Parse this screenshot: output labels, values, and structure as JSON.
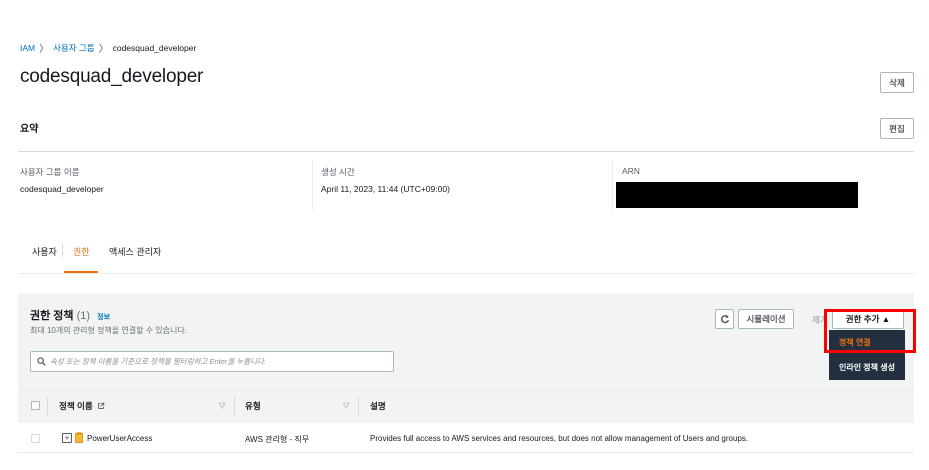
{
  "breadcrumb": {
    "root": "IAM",
    "sep": "〉",
    "middle": "사용자 그룹",
    "current": "codesquad_developer"
  },
  "page": {
    "title": "codesquad_developer",
    "delete_label": "삭제"
  },
  "summary": {
    "title": "요약",
    "edit_label": "편집",
    "fields": [
      {
        "label": "사용자 그룹 이름",
        "value": "codesquad_developer"
      },
      {
        "label": "생성 시간",
        "value": "April 11, 2023, 11:44 (UTC+09:00)"
      },
      {
        "label": "ARN",
        "value": ""
      }
    ]
  },
  "tabs": [
    {
      "label": "사용자"
    },
    {
      "label": "권한"
    },
    {
      "label": "액세스 관리자"
    }
  ],
  "permissions": {
    "title": "권한 정책",
    "count": "(1)",
    "info_label": "정보",
    "subtitle": "최대 10개의 관리형 정책을 연결할 수 있습니다.",
    "search_placeholder": "속성 또는 정책 이름을 기준으로 정책을 필터링하고 Enter를 누릅니다.",
    "simulate_label": "시뮬레이션",
    "remove_label": "제거",
    "add_label": "권한 추가 ▲",
    "dropdown": {
      "attach_label": "정책 연결",
      "inline_label": "인라인 정책 생성"
    },
    "columns": {
      "name": "정책 이름",
      "type": "유형",
      "description": "설명"
    },
    "rows": [
      {
        "name": "PowerUserAccess",
        "type": "AWS 관리형 - 직무",
        "description": "Provides full access to AWS services and resources, but does not allow management of Users and groups."
      }
    ]
  },
  "colors": {
    "accent": "#ec7211",
    "link": "#0073bb",
    "highlight": "#ff0000",
    "dropdown_bg": "#232f3e"
  }
}
